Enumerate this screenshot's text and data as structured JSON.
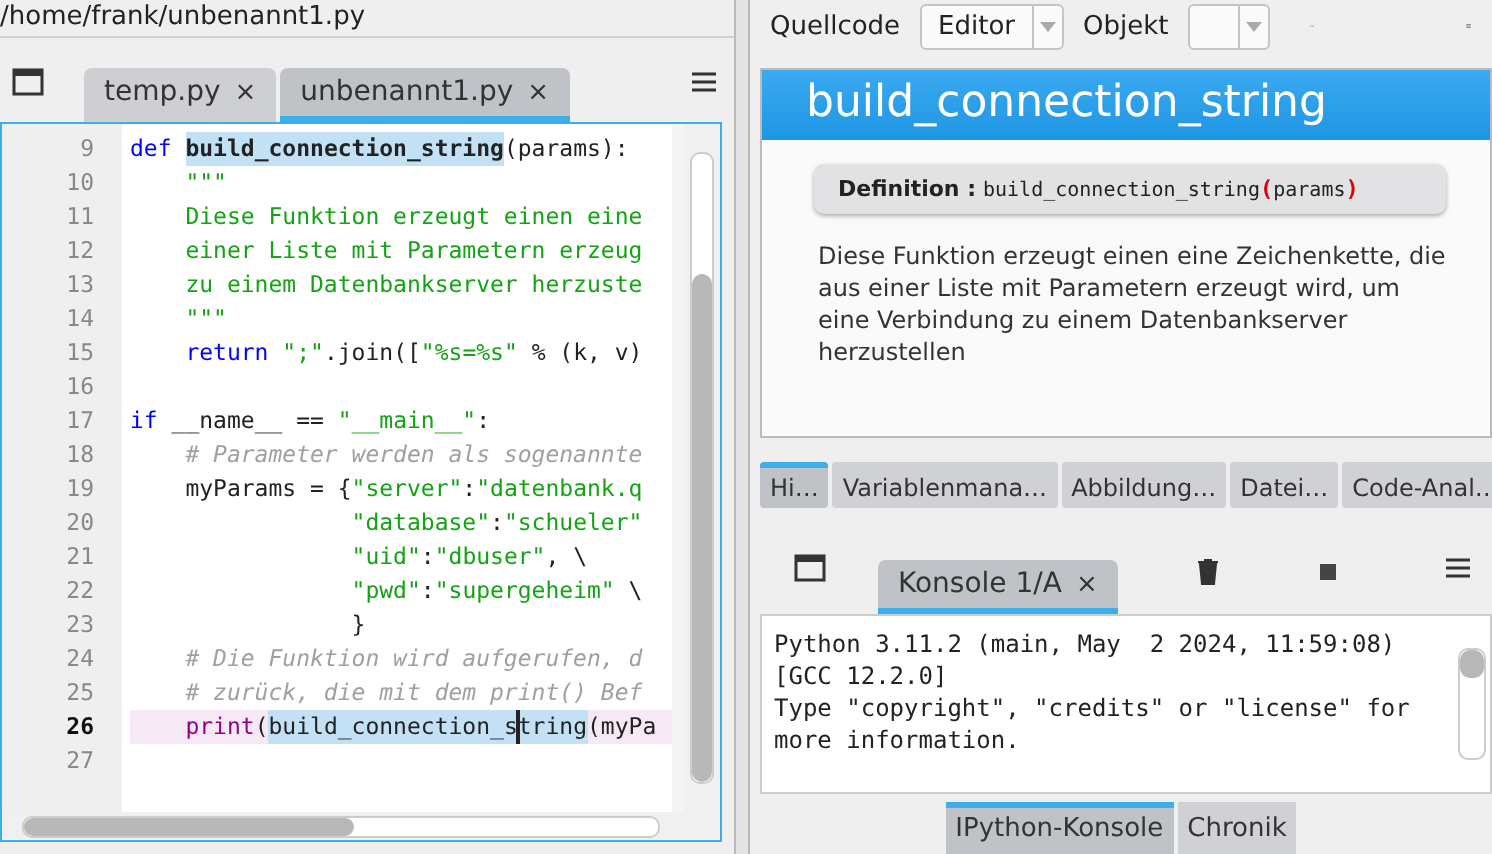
{
  "left_pane": {
    "path": "/home/frank/unbenannt1.py",
    "editor_tabs": [
      {
        "label": "temp.py",
        "close": "×",
        "selected": false
      },
      {
        "label": "unbenannt1.py",
        "close": "×",
        "selected": true
      }
    ],
    "editor": {
      "lines": [
        {
          "number": "9",
          "current": false,
          "segments": [
            {
              "text": "def ",
              "kind": "keyword"
            },
            {
              "text": "build_connection_string",
              "kind": "definition_match"
            },
            {
              "text": "(params):",
              "kind": "plain"
            }
          ]
        },
        {
          "number": "10",
          "current": false,
          "segments": [
            {
              "text": "    \"\"\"",
              "kind": "string"
            }
          ]
        },
        {
          "number": "11",
          "current": false,
          "segments": [
            {
              "text": "    Diese Funktion erzeugt einen eine",
              "kind": "string"
            }
          ]
        },
        {
          "number": "12",
          "current": false,
          "segments": [
            {
              "text": "    einer Liste mit Parametern erzeug",
              "kind": "string"
            }
          ]
        },
        {
          "number": "13",
          "current": false,
          "segments": [
            {
              "text": "    zu einem Datenbankserver herzuste",
              "kind": "string"
            }
          ]
        },
        {
          "number": "14",
          "current": false,
          "segments": [
            {
              "text": "    \"\"\"",
              "kind": "string"
            }
          ]
        },
        {
          "number": "15",
          "current": false,
          "segments": [
            {
              "text": "    return ",
              "kind": "keyword"
            },
            {
              "text": "\";\"",
              "kind": "string"
            },
            {
              "text": ".join([",
              "kind": "plain"
            },
            {
              "text": "\"%s=%s\"",
              "kind": "string"
            },
            {
              "text": " % (k, v)",
              "kind": "plain"
            }
          ]
        },
        {
          "number": "16",
          "current": false
        },
        {
          "number": "17",
          "current": false,
          "segments": [
            {
              "text": "if",
              "kind": "keyword"
            },
            {
              "text": " __name__ == ",
              "kind": "plain"
            },
            {
              "text": "\"__main__\"",
              "kind": "string"
            },
            {
              "text": ":",
              "kind": "plain"
            }
          ]
        },
        {
          "number": "18",
          "current": false,
          "segments": [
            {
              "text": "    # Parameter werden als sogenannte",
              "kind": "comment"
            }
          ]
        },
        {
          "number": "19",
          "current": false,
          "segments": [
            {
              "text": "    myParams = {",
              "kind": "plain"
            },
            {
              "text": "\"server\"",
              "kind": "string"
            },
            {
              "text": ":",
              "kind": "plain"
            },
            {
              "text": "\"datenbank.q",
              "kind": "string"
            }
          ]
        },
        {
          "number": "20",
          "current": false,
          "segments": [
            {
              "text": "                \"database\"",
              "kind": "string"
            },
            {
              "text": ":",
              "kind": "plain"
            },
            {
              "text": "\"schueler\"",
              "kind": "string"
            }
          ]
        },
        {
          "number": "21",
          "current": false,
          "segments": [
            {
              "text": "                \"uid\"",
              "kind": "string"
            },
            {
              "text": ":",
              "kind": "plain"
            },
            {
              "text": "\"dbuser\"",
              "kind": "string"
            },
            {
              "text": ", \\",
              "kind": "plain"
            }
          ]
        },
        {
          "number": "22",
          "current": false,
          "segments": [
            {
              "text": "                \"pwd\"",
              "kind": "string"
            },
            {
              "text": ":",
              "kind": "plain"
            },
            {
              "text": "\"supergeheim\"",
              "kind": "string"
            },
            {
              "text": " \\",
              "kind": "plain"
            }
          ]
        },
        {
          "number": "23",
          "current": false,
          "segments": [
            {
              "text": "                }",
              "kind": "plain"
            }
          ]
        },
        {
          "number": "24",
          "current": false,
          "segments": [
            {
              "text": "    # Die Funktion wird aufgerufen, d",
              "kind": "comment"
            }
          ]
        },
        {
          "number": "25",
          "current": false,
          "segments": [
            {
              "text": "    # zurück, die mit dem print() Bef",
              "kind": "comment"
            }
          ]
        },
        {
          "number": "26",
          "current": true,
          "segments": [
            {
              "text": "    print",
              "kind": "builtin"
            },
            {
              "text": "(",
              "kind": "plain"
            },
            {
              "text": "build_connection_s",
              "kind": "match"
            },
            {
              "kind": "caret"
            },
            {
              "text": "tring",
              "kind": "match"
            },
            {
              "text": "(myPa",
              "kind": "plain"
            }
          ]
        },
        {
          "number": "27",
          "current": false
        }
      ]
    }
  },
  "right_pane": {
    "toolbar": {
      "source_label": "Quellcode",
      "source_value": "Editor",
      "object_label": "Objekt"
    },
    "help": {
      "title": "build_connection_string",
      "definition_label": "Definition :",
      "definition_name": "build_connection_string",
      "definition_open": "(",
      "definition_params": "params",
      "definition_close": ")",
      "description": "Diese Funktion erzeugt einen eine Zeichenkette, die aus einer Liste mit Parametern erzeugt wird, um eine Verbindung zu einem Datenbankserver herzustellen"
    },
    "pane_tabs": [
      {
        "label": "Hi…",
        "selected": true
      },
      {
        "label": "Variablenmana…",
        "selected": false
      },
      {
        "label": "Abbildung…",
        "selected": false
      },
      {
        "label": "Datei…",
        "selected": false
      },
      {
        "label": "Code-Anal…",
        "selected": false
      }
    ],
    "console_tabs": [
      {
        "label": "Konsole 1/A",
        "close": "×",
        "selected": true
      }
    ],
    "console": {
      "lines": [
        "Python 3.11.2 (main, May  2 2024, 11:59:08)",
        "[GCC 12.2.0]",
        "Type \"copyright\", \"credits\" or \"license\" for",
        "more information."
      ]
    },
    "bottom_tabs": [
      {
        "label": "IPython-Konsole",
        "selected": true
      },
      {
        "label": "Chronik",
        "selected": false
      }
    ]
  }
}
